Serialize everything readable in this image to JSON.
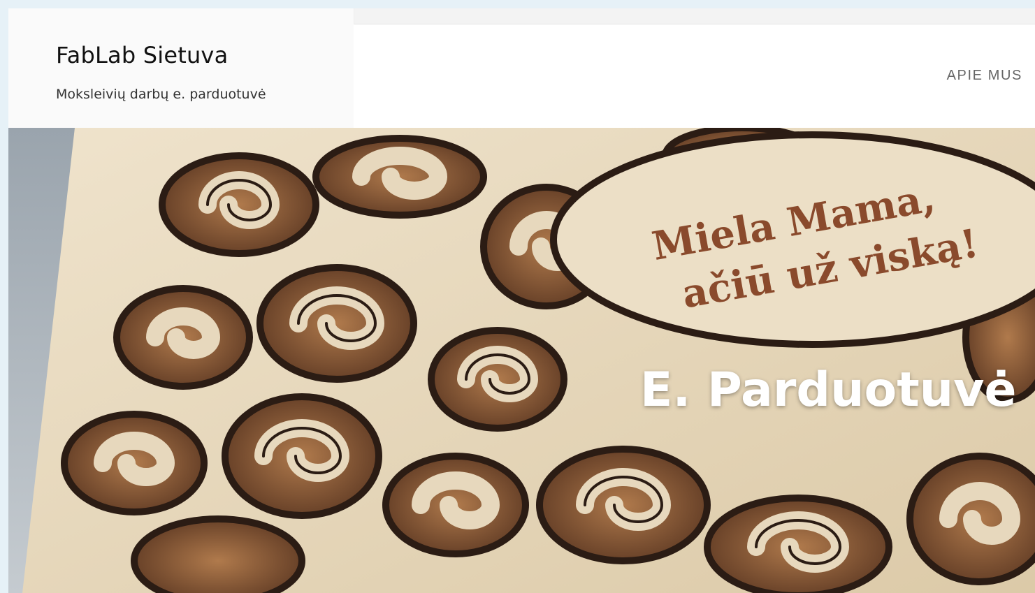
{
  "site": {
    "title": "FabLab Sietuva",
    "description": "Moksleivių darbų e. parduotuvė"
  },
  "nav": {
    "items": [
      {
        "label": "APIE MUS"
      }
    ]
  },
  "hero": {
    "heading": "E. Parduotuvė",
    "image_text": {
      "line1": "Miela Mama,",
      "line2": "ačiū už viską!"
    }
  },
  "colors": {
    "page_background": "#e6f1f7",
    "wood_light": "#e9dcc4",
    "wood_dark": "#2b1c14",
    "engraving": "#8a4a2c"
  }
}
